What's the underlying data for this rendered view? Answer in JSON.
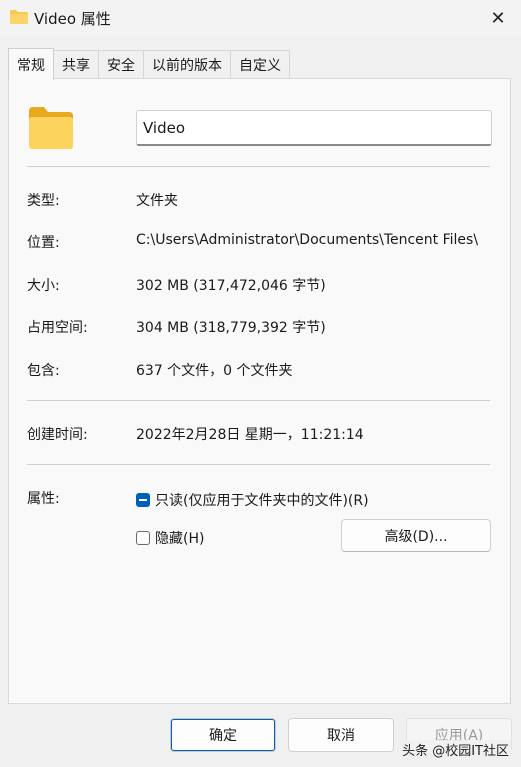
{
  "window": {
    "title": "Video 属性",
    "close_glyph": "✕"
  },
  "tabs": [
    {
      "label": "常规",
      "active": true
    },
    {
      "label": "共享",
      "active": false
    },
    {
      "label": "安全",
      "active": false
    },
    {
      "label": "以前的版本",
      "active": false
    },
    {
      "label": "自定义",
      "active": false
    }
  ],
  "general": {
    "name_value": "Video",
    "rows": [
      {
        "label": "类型:",
        "value": "文件夹"
      },
      {
        "label": "位置:",
        "value": "C:\\Users\\Administrator\\Documents\\Tencent Files\\"
      },
      {
        "label": "大小:",
        "value": "302 MB (317,472,046 字节)"
      },
      {
        "label": "占用空间:",
        "value": "304 MB (318,779,392 字节)"
      },
      {
        "label": "包含:",
        "value": "637 个文件，0 个文件夹"
      }
    ],
    "created_label": "创建时间:",
    "created_value": "2022年2月28日 星期一，11:21:14",
    "attributes_label": "属性:",
    "readonly_label": "只读(仅应用于文件夹中的文件)(R)",
    "readonly_state": "indeterminate",
    "hidden_label": "隐藏(H)",
    "hidden_state": "unchecked",
    "advanced_label": "高级(D)..."
  },
  "footer": {
    "ok_label": "确定",
    "cancel_label": "取消",
    "apply_label": "应用(A)"
  },
  "watermark": "头条 @校园IT社区",
  "colors": {
    "accent": "#005fb8",
    "folder": "#f8c74b"
  }
}
